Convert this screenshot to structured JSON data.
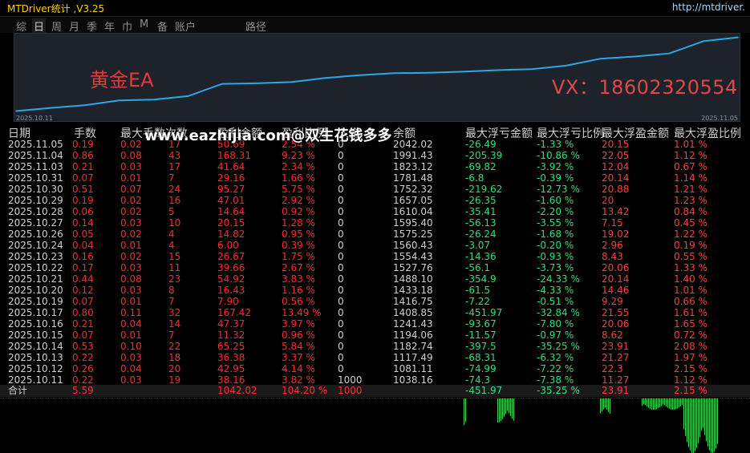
{
  "window": {
    "title": "MTDriver统计 ,V3.25",
    "url": "http://mtdriver."
  },
  "toolbar": {
    "items": [
      "综",
      "日",
      "周",
      "月",
      "季",
      "年",
      "巾",
      "M",
      "备",
      "账户",
      "路径"
    ],
    "active": "日"
  },
  "chart": {
    "ea_label": "黄金EA",
    "vx_label": "VX：18602320554",
    "start_date": "2025.10.11",
    "end_date": "2025.11.05",
    "line_color": "#2aa8e6"
  },
  "watermark": "www.eazhijia.com@双生花钱多多",
  "table": {
    "headers": [
      "日期",
      "手数",
      "最大手数",
      "次数",
      "盈利金额",
      "盈利比例",
      "入金",
      "余额",
      "最大浮亏金额",
      "最大浮亏比例",
      "最大浮盈金额",
      "最大浮盈比例"
    ],
    "rows": [
      [
        "2025.11.05",
        "0.19",
        "0.02",
        "17",
        "50.69",
        "2.54 %",
        "0",
        "2042.02",
        "-26.49",
        "-1.33 %",
        "20.15",
        "1.01 %"
      ],
      [
        "2025.11.04",
        "0.86",
        "0.08",
        "43",
        "168.31",
        "9.23 %",
        "0",
        "1991.43",
        "-205.39",
        "-10.86 %",
        "22.05",
        "1.12 %"
      ],
      [
        "2025.11.03",
        "0.21",
        "0.03",
        "17",
        "41.64",
        "2.34 %",
        "0",
        "1823.12",
        "-69.82",
        "-3.92 %",
        "12.04",
        "0.67 %"
      ],
      [
        "2025.10.31",
        "0.07",
        "0.01",
        "7",
        "29.16",
        "1.66 %",
        "0",
        "1781.48",
        "-6.8",
        "-0.39 %",
        "20.14",
        "1.14 %"
      ],
      [
        "2025.10.30",
        "0.51",
        "0.07",
        "24",
        "95.27",
        "5.75 %",
        "0",
        "1752.32",
        "-219.62",
        "-12.73 %",
        "20.88",
        "1.21 %"
      ],
      [
        "2025.10.29",
        "0.19",
        "0.02",
        "16",
        "47.01",
        "2.92 %",
        "0",
        "1657.05",
        "-26.35",
        "-1.60 %",
        "20",
        "1.23 %"
      ],
      [
        "2025.10.28",
        "0.06",
        "0.02",
        "5",
        "14.64",
        "0.92 %",
        "0",
        "1610.04",
        "-35.41",
        "-2.20 %",
        "13.42",
        "0.84 %"
      ],
      [
        "2025.10.27",
        "0.14",
        "0.03",
        "10",
        "20.15",
        "1.28 %",
        "0",
        "1595.40",
        "-56.13",
        "-3.55 %",
        "7.15",
        "0.45 %"
      ],
      [
        "2025.10.26",
        "0.05",
        "0.02",
        "4",
        "14.82",
        "0.95 %",
        "0",
        "1575.25",
        "-26.24",
        "-1.68 %",
        "19.02",
        "1.22 %"
      ],
      [
        "2025.10.24",
        "0.04",
        "0.01",
        "4",
        "6.00",
        "0.39 %",
        "0",
        "1560.43",
        "-3.07",
        "-0.20 %",
        "2.96",
        "0.19 %"
      ],
      [
        "2025.10.23",
        "0.16",
        "0.02",
        "15",
        "26.67",
        "1.75 %",
        "0",
        "1554.43",
        "-14.36",
        "-0.93 %",
        "8.43",
        "0.55 %"
      ],
      [
        "2025.10.22",
        "0.17",
        "0.03",
        "11",
        "39.66",
        "2.67 %",
        "0",
        "1527.76",
        "-56.1",
        "-3.73 %",
        "20.06",
        "1.33 %"
      ],
      [
        "2025.10.21",
        "0.44",
        "0.08",
        "23",
        "54.92",
        "3.83 %",
        "0",
        "1488.10",
        "-354.9",
        "-24.33 %",
        "20.14",
        "1.40 %"
      ],
      [
        "2025.10.20",
        "0.12",
        "0.03",
        "8",
        "16.43",
        "1.16 %",
        "0",
        "1433.18",
        "-61.5",
        "-4.33 %",
        "14.46",
        "1.01 %"
      ],
      [
        "2025.10.19",
        "0.07",
        "0.01",
        "7",
        "7.90",
        "0.56 %",
        "0",
        "1416.75",
        "-7.22",
        "-0.51 %",
        "9.29",
        "0.66 %"
      ],
      [
        "2025.10.17",
        "0.80",
        "0.11",
        "32",
        "167.42",
        "13.49 %",
        "0",
        "1408.85",
        "-451.97",
        "-32.84 %",
        "21.55",
        "1.61 %"
      ],
      [
        "2025.10.16",
        "0.21",
        "0.04",
        "14",
        "47.37",
        "3.97 %",
        "0",
        "1241.43",
        "-93.67",
        "-7.80 %",
        "20.06",
        "1.65 %"
      ],
      [
        "2025.10.15",
        "0.07",
        "0.01",
        "7",
        "11.32",
        "0.96 %",
        "0",
        "1194.06",
        "-11.57",
        "-0.97 %",
        "8.62",
        "0.72 %"
      ],
      [
        "2025.10.14",
        "0.53",
        "0.10",
        "22",
        "65.25",
        "5.84 %",
        "0",
        "1182.74",
        "-397.5",
        "-35.25 %",
        "23.91",
        "2.08 %"
      ],
      [
        "2025.10.13",
        "0.22",
        "0.03",
        "18",
        "36.38",
        "3.37 %",
        "0",
        "1117.49",
        "-68.31",
        "-6.32 %",
        "21.27",
        "1.97 %"
      ],
      [
        "2025.10.12",
        "0.26",
        "0.04",
        "20",
        "42.95",
        "4.14 %",
        "0",
        "1081.11",
        "-74.99",
        "-7.22 %",
        "22.3",
        "2.15 %"
      ],
      [
        "2025.10.11",
        "0.22",
        "0.03",
        "19",
        "38.16",
        "3.82 %",
        "1000",
        "1038.16",
        "-74.3",
        "-7.38 %",
        "11.27",
        "1.12 %"
      ]
    ],
    "total": [
      "合计",
      "5.59",
      "",
      "",
      "1042.02",
      "104.20 %",
      "1000",
      "",
      "-451.97",
      "-35.25 %",
      "23.91",
      "2.15 %"
    ]
  },
  "chart_data": {
    "type": "line",
    "x": [
      "2025.10.11",
      "2025.10.12",
      "2025.10.13",
      "2025.10.14",
      "2025.10.15",
      "2025.10.16",
      "2025.10.17",
      "2025.10.19",
      "2025.10.20",
      "2025.10.21",
      "2025.10.22",
      "2025.10.23",
      "2025.10.24",
      "2025.10.26",
      "2025.10.27",
      "2025.10.28",
      "2025.10.29",
      "2025.10.30",
      "2025.10.31",
      "2025.11.03",
      "2025.11.04",
      "2025.11.05"
    ],
    "y": [
      1038.16,
      1081.11,
      1117.49,
      1182.74,
      1194.06,
      1241.43,
      1408.85,
      1416.75,
      1433.18,
      1488.1,
      1527.76,
      1554.43,
      1560.43,
      1575.25,
      1595.4,
      1610.04,
      1657.05,
      1752.32,
      1781.48,
      1823.12,
      1991.43,
      2042.02
    ],
    "xlabel": "",
    "ylabel": ""
  }
}
